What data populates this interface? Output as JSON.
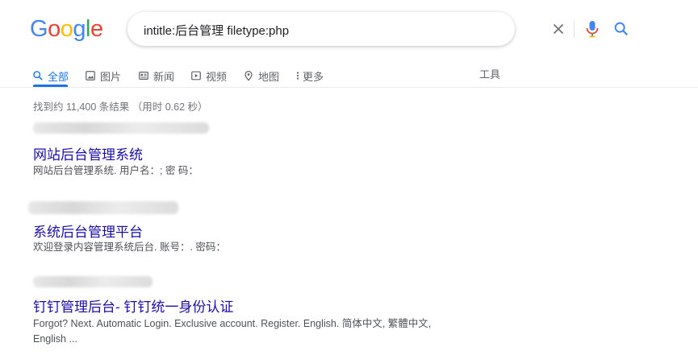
{
  "logo": {
    "letters": [
      "G",
      "o",
      "o",
      "g",
      "l",
      "e"
    ],
    "colors": [
      "#4285F4",
      "#EA4335",
      "#FBBC05",
      "#4285F4",
      "#34A853",
      "#EA4335"
    ]
  },
  "search": {
    "query": "intitle:后台管理 filetype:php"
  },
  "tabs": [
    {
      "label": "全部",
      "icon": "search-icon",
      "active": true
    },
    {
      "label": "图片",
      "icon": "image-icon"
    },
    {
      "label": "新闻",
      "icon": "news-icon"
    },
    {
      "label": "视频",
      "icon": "video-icon"
    },
    {
      "label": "地图",
      "icon": "map-pin-icon"
    },
    {
      "label": "更多",
      "icon": "more-vert-icon"
    }
  ],
  "tools_label": "工具",
  "stats": "找到约 11,400 条结果 （用时 0.62 秒）",
  "results": [
    {
      "title": "网站后台管理系统",
      "snippet": "网站后台管理系统. 用户名：; 密 码："
    },
    {
      "title": "系统后台管理平台",
      "snippet": "欢迎登录内容管理系统后台. 账号：. 密码："
    },
    {
      "title": "钉钉管理后台- 钉钉统一身份认证",
      "snippet": "Forgot? Next. Automatic Login. Exclusive account. Register. English. 简体中文, 繁體中文, English ..."
    }
  ],
  "colors": {
    "accent": "#1a73e8",
    "link": "#1a0dab",
    "muted": "#70757a"
  }
}
